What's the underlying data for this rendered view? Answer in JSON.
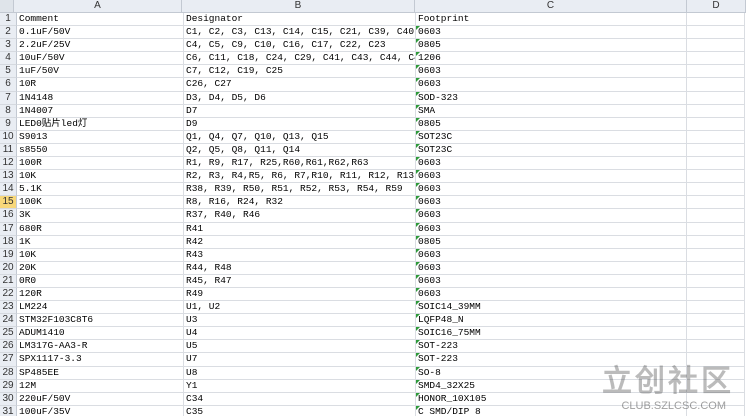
{
  "columns": [
    "A",
    "B",
    "C",
    "D"
  ],
  "rows": [
    {
      "n": "1",
      "a": "Comment",
      "b": "Designator",
      "c": "Footprint"
    },
    {
      "n": "2",
      "a": "0.1uF/50V",
      "b": "C1, C2, C3, C13, C14, C15, C21, C39, C40",
      "c": "0603"
    },
    {
      "n": "3",
      "a": "2.2uF/25V",
      "b": "C4, C5, C9, C10, C16, C17, C22, C23",
      "c": "0805"
    },
    {
      "n": "4",
      "a": "10uF/50V",
      "b": "C6, C11, C18, C24, C29, C41, C43, C44, C4",
      "c": "1206"
    },
    {
      "n": "5",
      "a": "1uF/50V",
      "b": "C7, C12, C19, C25",
      "c": "0603"
    },
    {
      "n": "6",
      "a": "10R",
      "b": "C26, C27",
      "c": "0603"
    },
    {
      "n": "7",
      "a": "1N4148",
      "b": "D3, D4, D5, D6",
      "c": "SOD-323"
    },
    {
      "n": "8",
      "a": "1N4007",
      "b": "D7",
      "c": "SMA"
    },
    {
      "n": "9",
      "a": "LED0贴片led灯",
      "b": "D9",
      "c": "0805"
    },
    {
      "n": "10",
      "a": "S9013",
      "b": "Q1, Q4, Q7, Q10, Q13, Q15",
      "c": "SOT23C"
    },
    {
      "n": "11",
      "a": "s8550",
      "b": "Q2, Q5, Q8, Q11, Q14",
      "c": "SOT23C"
    },
    {
      "n": "12",
      "a": "100R",
      "b": "R1, R9, R17, R25,R60,R61,R62,R63",
      "c": "0603"
    },
    {
      "n": "13",
      "a": "10K",
      "b": "R2, R3, R4,R5, R6, R7,R10, R11, R12, R13",
      "c": "0603"
    },
    {
      "n": "14",
      "a": "5.1K",
      "b": "R38, R39, R50, R51, R52, R53, R54, R59",
      "c": "0603"
    },
    {
      "n": "15",
      "a": "100K",
      "b": "R8, R16, R24, R32",
      "c": "0603",
      "active": true
    },
    {
      "n": "16",
      "a": "3K",
      "b": "R37, R40, R46",
      "c": "0603"
    },
    {
      "n": "17",
      "a": "680R",
      "b": "R41",
      "c": "0603"
    },
    {
      "n": "18",
      "a": "1K",
      "b": "R42",
      "c": "0805"
    },
    {
      "n": "19",
      "a": "10K",
      "b": "R43",
      "c": "0603"
    },
    {
      "n": "20",
      "a": "20K",
      "b": "R44, R48",
      "c": "0603"
    },
    {
      "n": "21",
      "a": "0R0",
      "b": "R45, R47",
      "c": "0603"
    },
    {
      "n": "22",
      "a": "120R",
      "b": "R49",
      "c": "0603"
    },
    {
      "n": "23",
      "a": "LM224",
      "b": "U1, U2",
      "c": "SOIC14_39MM"
    },
    {
      "n": "24",
      "a": "STM32F103C8T6",
      "b": "U3",
      "c": "LQFP48_N"
    },
    {
      "n": "25",
      "a": "ADUM1410",
      "b": "U4",
      "c": "SOIC16_75MM"
    },
    {
      "n": "26",
      "a": "LM317G-AA3-R",
      "b": "U5",
      "c": "SOT-223"
    },
    {
      "n": "27",
      "a": "SPX1117-3.3",
      "b": "U7",
      "c": "SOT-223"
    },
    {
      "n": "28",
      "a": "SP485EE",
      "b": "U8",
      "c": "SO-8"
    },
    {
      "n": "29",
      "a": "12M",
      "b": "Y1",
      "c": "SMD4_32X25"
    },
    {
      "n": "30",
      "a": "220uF/50V",
      "b": "C34",
      "c": "HONOR_10X105"
    },
    {
      "n": "31",
      "a": "100uF/35V",
      "b": "C35",
      "c": "C SMD/DIP 8"
    }
  ],
  "watermark": {
    "logo": "立创社区",
    "url": "CLUB.SZLCSC.COM"
  },
  "accent": {
    "flag": "#2e9a3a",
    "active_row": "#f8d87a"
  }
}
